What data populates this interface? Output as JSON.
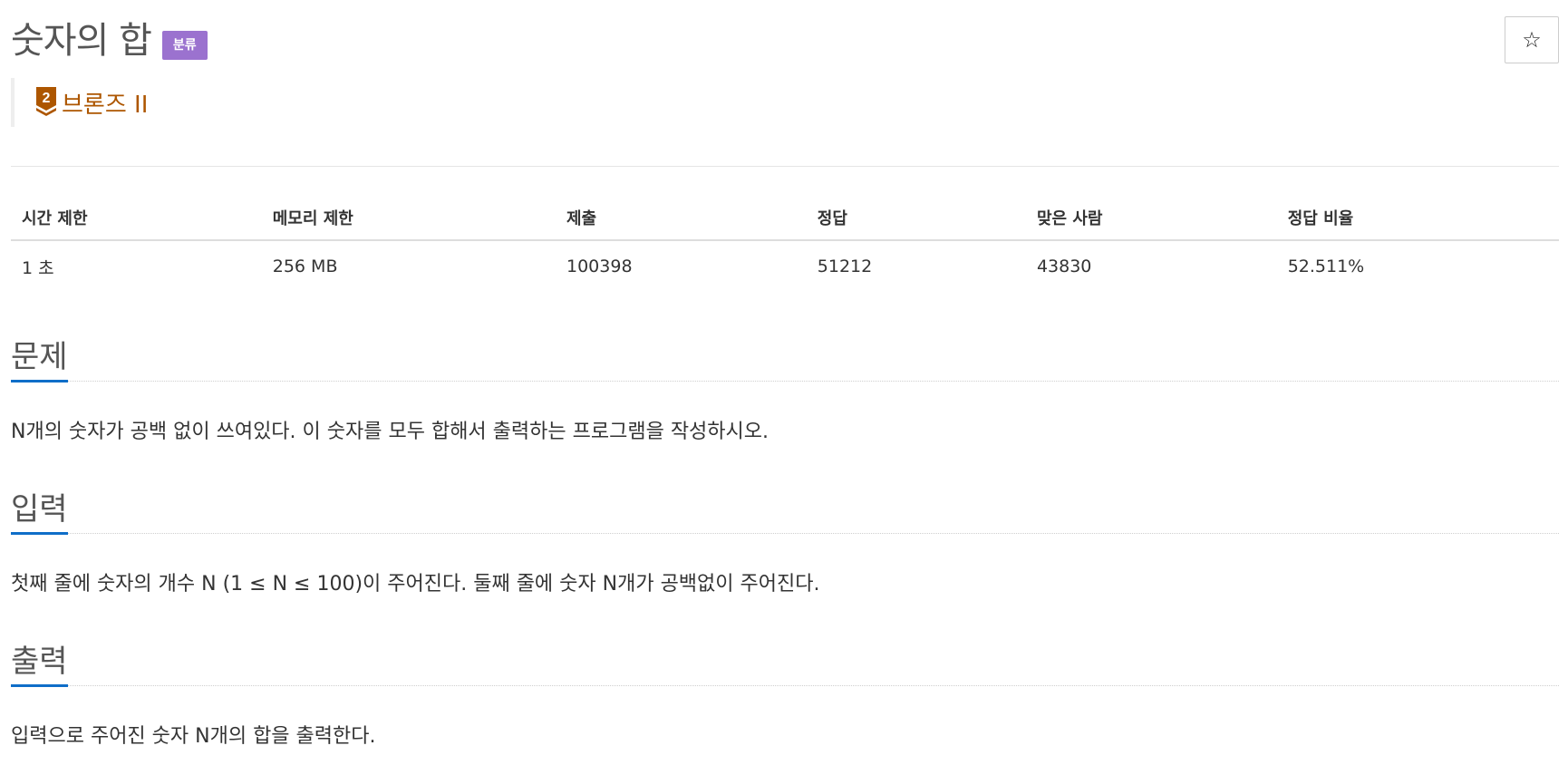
{
  "problem": {
    "title": "숫자의 합",
    "category_badge": "분류",
    "tier": {
      "number": "2",
      "label": "브론즈 II",
      "color": "#ad5600",
      "icon": "bronze-tier-icon"
    },
    "star_icon": "☆"
  },
  "info_table": {
    "headers": [
      "시간 제한",
      "메모리 제한",
      "제출",
      "정답",
      "맞은 사람",
      "정답 비율"
    ],
    "values": [
      "1 초",
      "256 MB",
      "100398",
      "51212",
      "43830",
      "52.511%"
    ]
  },
  "sections": {
    "description": {
      "heading": "문제",
      "text": "N개의 숫자가 공백 없이 쓰여있다. 이 숫자를 모두 합해서 출력하는 프로그램을 작성하시오."
    },
    "input": {
      "heading": "입력",
      "text": "첫째 줄에 숫자의 개수 N (1 ≤ N ≤ 100)이 주어진다. 둘째 줄에 숫자 N개가 공백없이 주어진다."
    },
    "output": {
      "heading": "출력",
      "text": "입력으로 주어진 숫자 N개의 합을 출력한다."
    }
  },
  "colors": {
    "badge": "#9b72cf",
    "tier": "#ad5600",
    "section_underline": "#0f6ec8"
  }
}
